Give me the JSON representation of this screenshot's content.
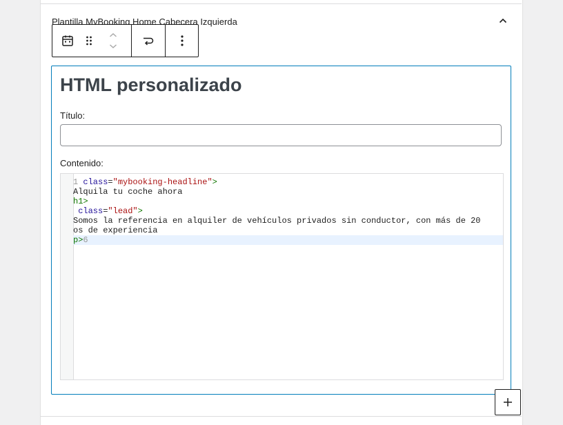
{
  "widget": {
    "title": "Plantilla MyBooking Home Cabecera Izquierda"
  },
  "toolbar": {
    "icons": [
      "calendar-icon",
      "drag-handle-icon",
      "chevron-up-icon",
      "chevron-down-icon",
      "transform-icon",
      "more-options-icon"
    ]
  },
  "block": {
    "heading": "HTML personalizado",
    "title_label": "Título:",
    "title_value": "",
    "content_label": "Contenido:"
  },
  "code_lines": [
    {
      "ln": "1",
      "parts": [
        {
          "t": " ",
          "c": ""
        },
        {
          "t": "class",
          "c": "attr"
        },
        {
          "t": "=",
          "c": ""
        },
        {
          "t": "\"mybooking-headline\"",
          "c": "str"
        },
        {
          "t": ">",
          "c": "tag"
        }
      ]
    },
    {
      "ln": "",
      "parts": [
        {
          "t": "Alquila tu coche ahora",
          "c": ""
        }
      ]
    },
    {
      "ln": "",
      "parts": [
        {
          "t": "h1>",
          "c": "tag"
        }
      ]
    },
    {
      "ln": "",
      "parts": [
        {
          "t": " ",
          "c": ""
        },
        {
          "t": "class",
          "c": "attr"
        },
        {
          "t": "=",
          "c": ""
        },
        {
          "t": "\"lead\"",
          "c": "str"
        },
        {
          "t": ">",
          "c": "tag"
        }
      ]
    },
    {
      "ln": "",
      "parts": [
        {
          "t": "Somos la referencia en alquiler de vehículos privados sin conductor, con más de 20",
          "c": ""
        }
      ]
    },
    {
      "ln": "",
      "parts": [
        {
          "t": "os de experiencia",
          "c": ""
        }
      ]
    },
    {
      "ln": "",
      "parts": [
        {
          "t": "p>",
          "c": "tag"
        },
        {
          "t": "6",
          "c": "lnum"
        }
      ]
    }
  ],
  "colors": {
    "accent": "#007cba",
    "attr": "#221199",
    "string": "#aa1111",
    "tag": "#117700"
  }
}
